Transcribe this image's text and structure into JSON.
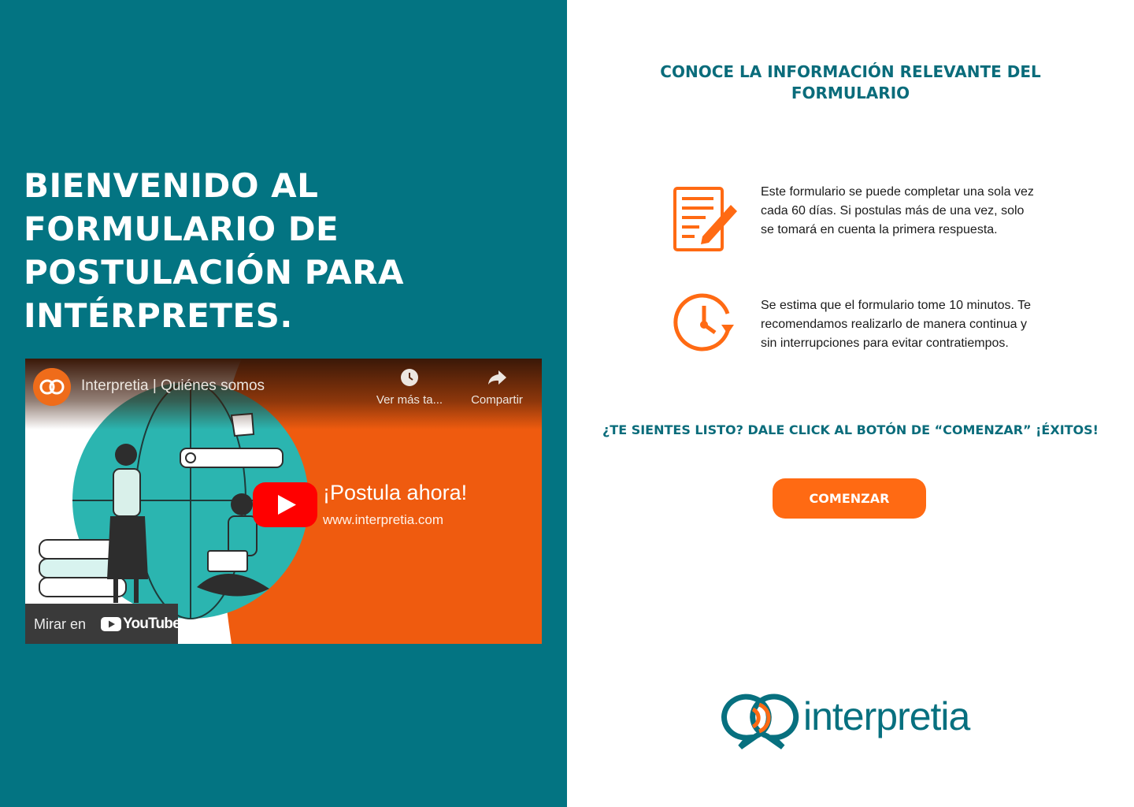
{
  "left": {
    "heading": "Bienvenido al formulario de postulación para intérpretes.",
    "video": {
      "channel_title": "Interpretia | Quiénes somos",
      "watch_later_label": "Ver más ta...",
      "share_label": "Compartir",
      "promo_title": "¡Postula ahora!",
      "promo_url": "www.interpretia.com",
      "watch_on_label": "Mirar en",
      "youtube_label": "YouTube"
    }
  },
  "right": {
    "section_title": "Conoce la información relevante del formulario",
    "info_items": [
      {
        "icon": "form-edit-icon",
        "text": "Este formulario se puede completar una sola vez cada 60 días. Si postulas más de una vez, solo se tomará en cuenta la primera respuesta."
      },
      {
        "icon": "clock-icon",
        "text": "Se estima que el formulario tome 10 minutos. Te recomendamos realizarlo de manera continua y sin interrupciones para evitar contratiempos."
      }
    ],
    "ready_text": "¿Te sientes listo? Dale click al botón de “Comenzar” ¡Éxitos!",
    "start_button": "Comenzar",
    "brand_name": "interpretia"
  },
  "colors": {
    "teal": "#037482",
    "orange": "#ff6a13",
    "youtube_red": "#ff0000"
  }
}
